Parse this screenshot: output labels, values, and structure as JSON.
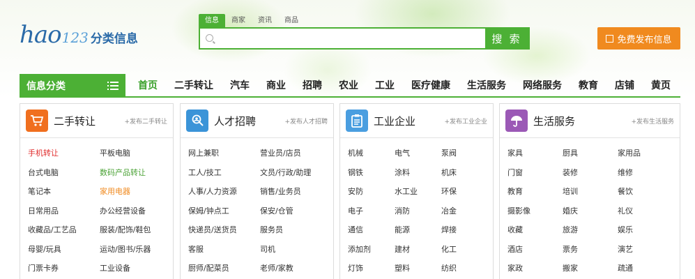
{
  "logo": {
    "hao": "hao",
    "num": "123",
    "cn": "分类信息"
  },
  "search": {
    "tabs": [
      "信息",
      "商家",
      "资讯",
      "商品"
    ],
    "active_tab": 0,
    "placeholder": "",
    "button": "搜 索"
  },
  "post_button": "免费发布信息",
  "nav": {
    "category_head": "信息分类",
    "items": [
      "首页",
      "二手转让",
      "汽车",
      "商业",
      "招聘",
      "农业",
      "工业",
      "医疗健康",
      "生活服务",
      "网络服务",
      "教育",
      "店铺",
      "黄页"
    ],
    "active": 0
  },
  "colors": {
    "accent": "#4cb035",
    "orange": "#f08a1f"
  },
  "cards": [
    {
      "title": "二手转让",
      "post": "+发布二手转让",
      "icon": "shopping-cart-icon",
      "color": "#f06f1f",
      "links": [
        {
          "t": "手机转让",
          "c": "red"
        },
        {
          "t": "平板电脑",
          "c": ""
        },
        {
          "t": "台式电脑",
          "c": ""
        },
        {
          "t": "数码产品转让",
          "c": "green"
        },
        {
          "t": "笔记本",
          "c": ""
        },
        {
          "t": "家用电器",
          "c": "orange"
        },
        {
          "t": "日常用品",
          "c": ""
        },
        {
          "t": "办公经营设备",
          "c": ""
        },
        {
          "t": "收藏品/工艺品",
          "c": ""
        },
        {
          "t": "服装/配饰/鞋包",
          "c": ""
        },
        {
          "t": "母婴/玩具",
          "c": ""
        },
        {
          "t": "运动/图书/乐器",
          "c": ""
        },
        {
          "t": "门票卡券",
          "c": ""
        },
        {
          "t": "工业设备",
          "c": ""
        }
      ]
    },
    {
      "title": "人才招聘",
      "post": "+发布人才招聘",
      "icon": "person-search-icon",
      "color": "#3b94d8",
      "links": [
        {
          "t": "网上兼职",
          "c": ""
        },
        {
          "t": "营业员/店员",
          "c": ""
        },
        {
          "t": "工人/技工",
          "c": ""
        },
        {
          "t": "文员/行政/助理",
          "c": ""
        },
        {
          "t": "人事/人力资源",
          "c": ""
        },
        {
          "t": "销售/业务员",
          "c": ""
        },
        {
          "t": "保姆/钟点工",
          "c": ""
        },
        {
          "t": "保安/仓管",
          "c": ""
        },
        {
          "t": "快递员/送货员",
          "c": ""
        },
        {
          "t": "服务员",
          "c": ""
        },
        {
          "t": "客服",
          "c": ""
        },
        {
          "t": "司机",
          "c": ""
        },
        {
          "t": "厨师/配菜员",
          "c": ""
        },
        {
          "t": "老师/家教",
          "c": ""
        }
      ]
    },
    {
      "title": "工业企业",
      "post": "+发布工业企业",
      "icon": "clipboard-icon",
      "color": "#4a9ee0",
      "links": [
        {
          "t": "机械",
          "c": ""
        },
        {
          "t": "电气",
          "c": ""
        },
        {
          "t": "泵阀",
          "c": ""
        },
        {
          "t": "钢铁",
          "c": ""
        },
        {
          "t": "涂料",
          "c": ""
        },
        {
          "t": "机床",
          "c": ""
        },
        {
          "t": "安防",
          "c": ""
        },
        {
          "t": "水工业",
          "c": ""
        },
        {
          "t": "环保",
          "c": ""
        },
        {
          "t": "电子",
          "c": ""
        },
        {
          "t": "消防",
          "c": ""
        },
        {
          "t": "冶金",
          "c": ""
        },
        {
          "t": "通信",
          "c": ""
        },
        {
          "t": "能源",
          "c": ""
        },
        {
          "t": "焊接",
          "c": ""
        },
        {
          "t": "添加剂",
          "c": ""
        },
        {
          "t": "建材",
          "c": ""
        },
        {
          "t": "化工",
          "c": ""
        },
        {
          "t": "灯饰",
          "c": ""
        },
        {
          "t": "塑料",
          "c": ""
        },
        {
          "t": "纺织",
          "c": ""
        }
      ]
    },
    {
      "title": "生活服务",
      "post": "+发布生活服务",
      "icon": "umbrella-icon",
      "color": "#9b59b6",
      "links": [
        {
          "t": "家具",
          "c": ""
        },
        {
          "t": "厨具",
          "c": ""
        },
        {
          "t": "家用品",
          "c": ""
        },
        {
          "t": "门窗",
          "c": ""
        },
        {
          "t": "装修",
          "c": ""
        },
        {
          "t": "维修",
          "c": ""
        },
        {
          "t": "教育",
          "c": ""
        },
        {
          "t": "培训",
          "c": ""
        },
        {
          "t": "餐饮",
          "c": ""
        },
        {
          "t": "摄影像",
          "c": ""
        },
        {
          "t": "婚庆",
          "c": ""
        },
        {
          "t": "礼仪",
          "c": ""
        },
        {
          "t": "收藏",
          "c": ""
        },
        {
          "t": "旅游",
          "c": ""
        },
        {
          "t": "娱乐",
          "c": ""
        },
        {
          "t": "酒店",
          "c": ""
        },
        {
          "t": "票务",
          "c": ""
        },
        {
          "t": "演艺",
          "c": ""
        },
        {
          "t": "家政",
          "c": ""
        },
        {
          "t": "搬家",
          "c": ""
        },
        {
          "t": "疏通",
          "c": ""
        }
      ]
    }
  ]
}
